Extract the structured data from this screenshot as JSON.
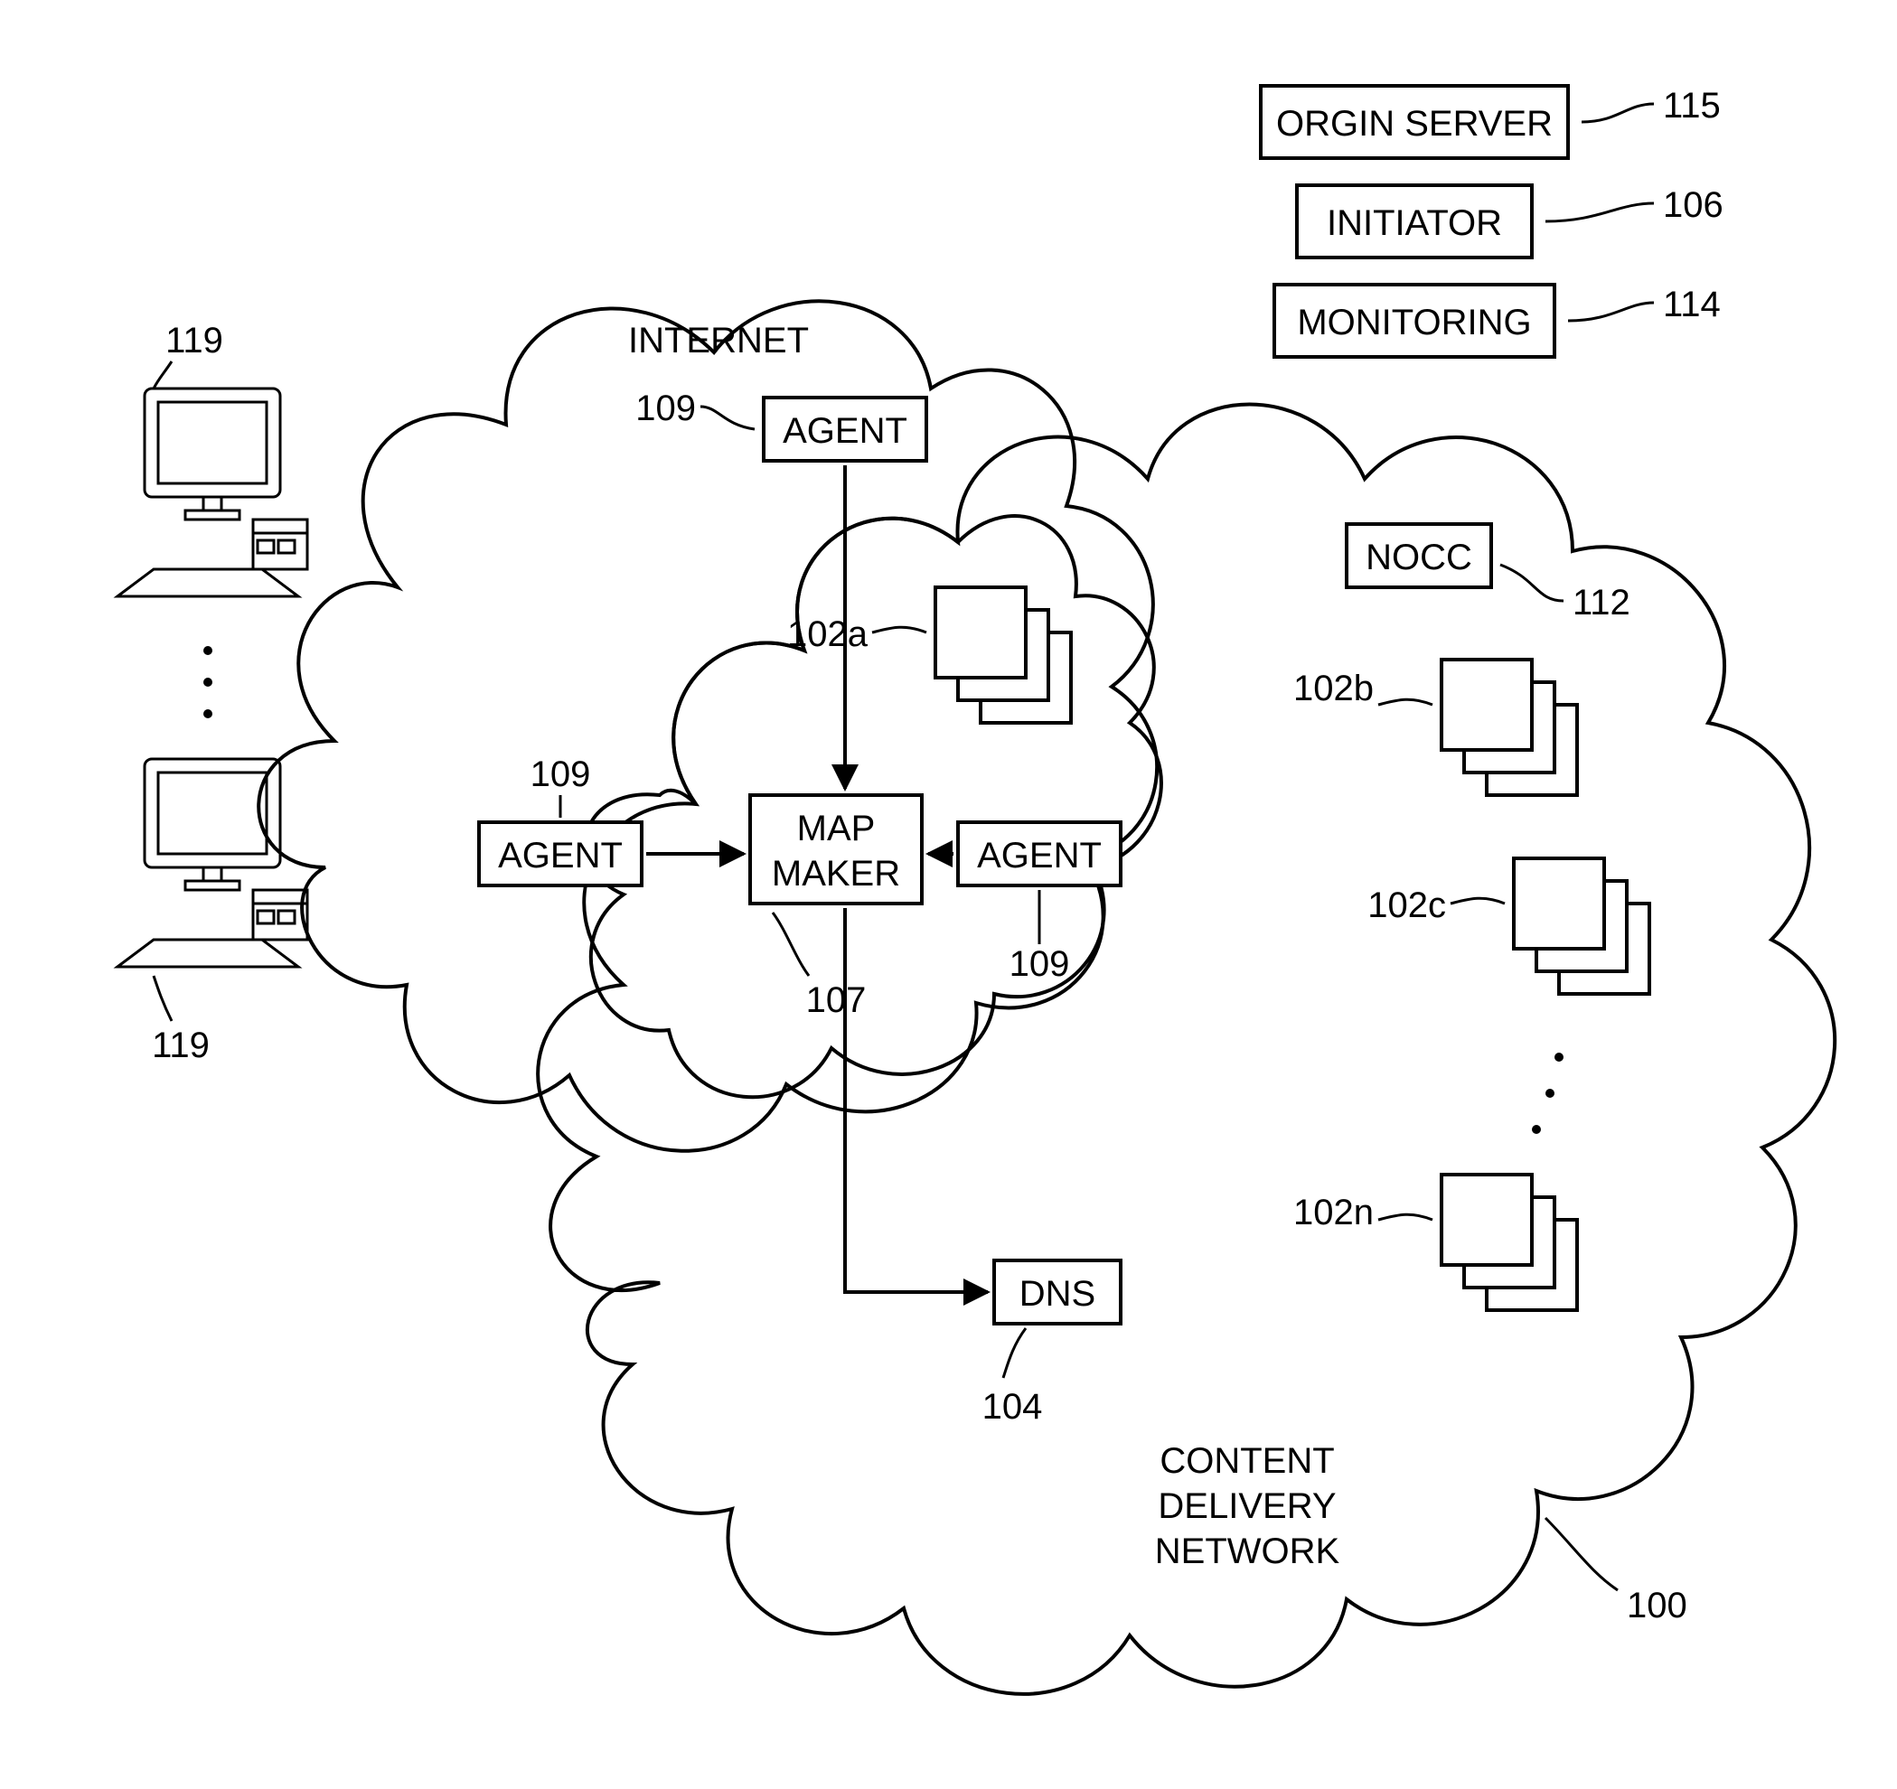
{
  "clouds": {
    "internet": "INTERNET",
    "cdn1": "CONTENT",
    "cdn2": "DELIVERY",
    "cdn3": "NETWORK"
  },
  "boxes": {
    "origin_server": "ORGIN SERVER",
    "initiator": "INITIATOR",
    "monitoring": "MONITORING",
    "agent_top": "AGENT",
    "agent_left": "AGENT",
    "agent_right": "AGENT",
    "map_maker1": "MAP",
    "map_maker2": "MAKER",
    "dns": "DNS",
    "nocc": "NOCC"
  },
  "refs": {
    "origin_server": "115",
    "initiator": "106",
    "monitoring": "114",
    "nocc": "112",
    "agent_top": "109",
    "agent_left": "109",
    "agent_right": "109",
    "map_maker": "107",
    "dns": "104",
    "cdn": "100",
    "server_a": "102a",
    "server_b": "102b",
    "server_c": "102c",
    "server_n": "102n",
    "pc_top": "119",
    "pc_bot": "119"
  }
}
